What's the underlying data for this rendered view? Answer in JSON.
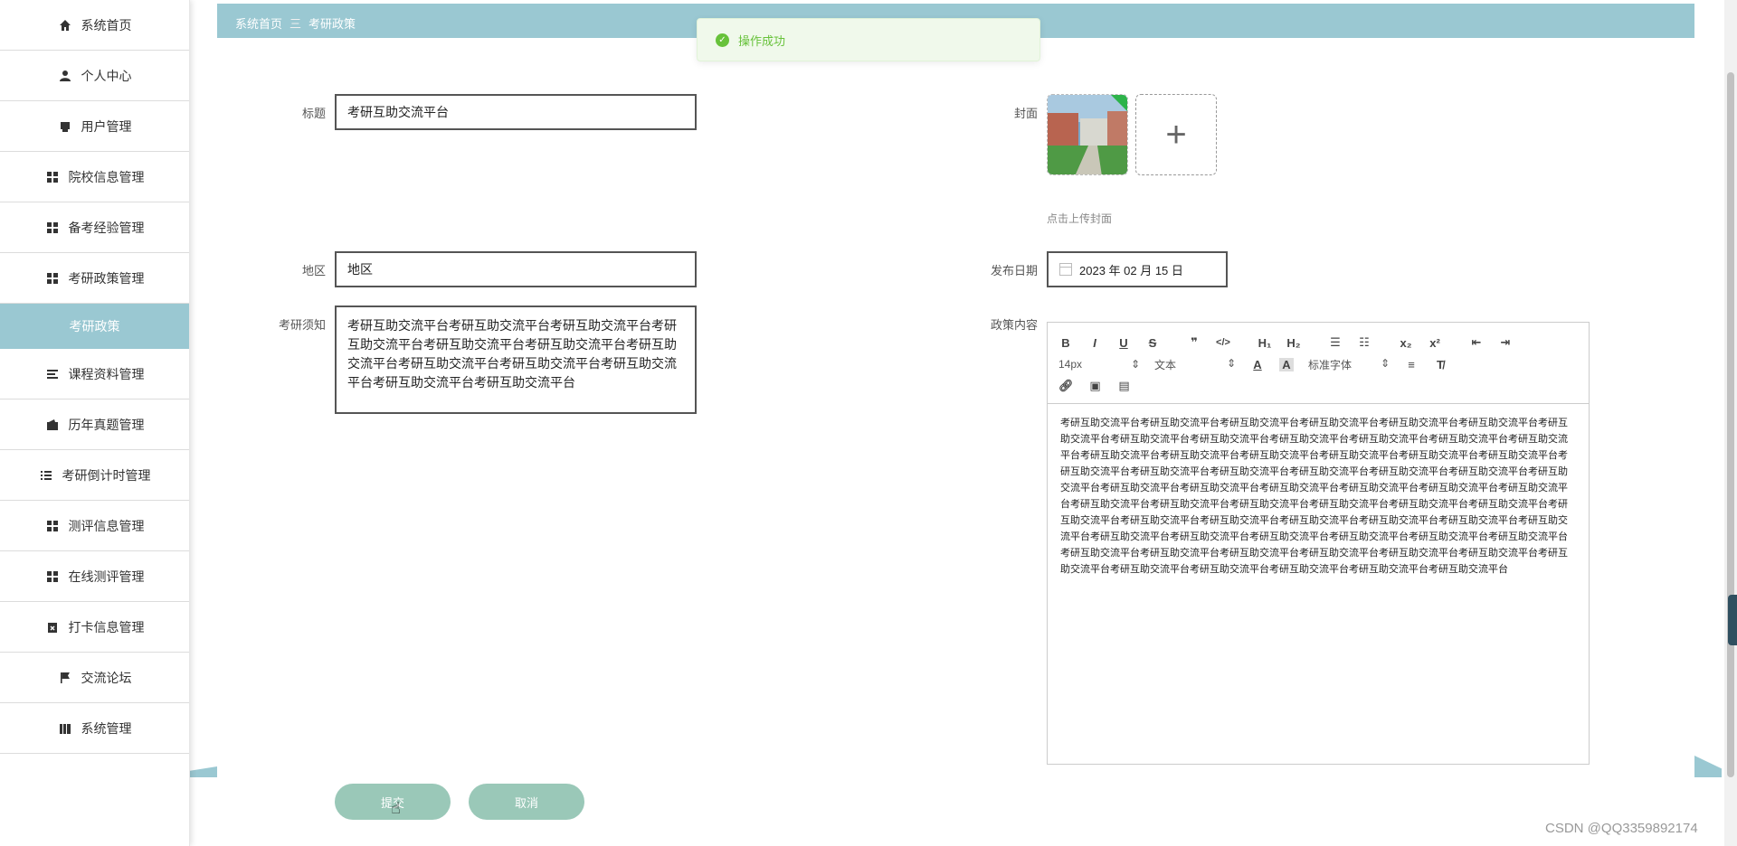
{
  "sidebar": {
    "items": [
      {
        "label": "系统首页",
        "icon": "home-icon"
      },
      {
        "label": "个人中心",
        "icon": "user-icon"
      },
      {
        "label": "用户管理",
        "icon": "printer-icon"
      },
      {
        "label": "院校信息管理",
        "icon": "grid-icon"
      },
      {
        "label": "备考经验管理",
        "icon": "grid-icon"
      },
      {
        "label": "考研政策管理",
        "icon": "grid-icon"
      },
      {
        "label": "考研政策",
        "icon": "",
        "active": true
      },
      {
        "label": "课程资料管理",
        "icon": "list-icon"
      },
      {
        "label": "历年真题管理",
        "icon": "wallet-icon"
      },
      {
        "label": "考研倒计时管理",
        "icon": "list-indent-icon"
      },
      {
        "label": "测评信息管理",
        "icon": "grid-icon"
      },
      {
        "label": "在线测评管理",
        "icon": "grid-icon"
      },
      {
        "label": "打卡信息管理",
        "icon": "clipboard-icon"
      },
      {
        "label": "交流论坛",
        "icon": "flag-icon"
      },
      {
        "label": "系统管理",
        "icon": "book-icon"
      }
    ]
  },
  "breadcrumb": {
    "home": "系统首页",
    "sep": "三",
    "current": "考研政策"
  },
  "toast": {
    "message": "操作成功"
  },
  "form": {
    "title_label": "标题",
    "title_value": "考研互助交流平台",
    "cover_label": "封面",
    "cover_hint": "点击上传封面",
    "region_label": "地区",
    "region_value": "地区",
    "date_label": "发布日期",
    "date_value": "2023 年 02 月 15 日",
    "notice_label": "考研须知",
    "notice_value": "考研互助交流平台考研互助交流平台考研互助交流平台考研互助交流平台考研互助交流平台考研互助交流平台考研互助交流平台考研互助交流平台考研互助交流平台考研互助交流平台考研互助交流平台考研互助交流平台",
    "content_label": "政策内容",
    "content_value": "考研互助交流平台考研互助交流平台考研互助交流平台考研互助交流平台考研互助交流平台考研互助交流平台考研互助交流平台考研互助交流平台考研互助交流平台考研互助交流平台考研互助交流平台考研互助交流平台考研互助交流平台考研互助交流平台考研互助交流平台考研互助交流平台考研互助交流平台考研互助交流平台考研互助交流平台考研互助交流平台考研互助交流平台考研互助交流平台考研互助交流平台考研互助交流平台考研互助交流平台考研互助交流平台考研互助交流平台考研互助交流平台考研互助交流平台考研互助交流平台考研互助交流平台考研互助交流平台考研互助交流平台考研互助交流平台考研互助交流平台考研互助交流平台考研互助交流平台考研互助交流平台考研互助交流平台考研互助交流平台考研互助交流平台考研互助交流平台考研互助交流平台考研互助交流平台考研互助交流平台考研互助交流平台考研互助交流平台考研互助交流平台考研互助交流平台考研互助交流平台考研互助交流平台考研互助交流平台考研互助交流平台考研互助交流平台考研互助交流平台考研互助交流平台考研互助交流平台考研互助交流平台考研互助交流平台考研互助交流平台考研互助交流平台考研互助交流平台考研互助交流平台"
  },
  "editor": {
    "font_size": "14px",
    "format": "文本",
    "font_family": "标准字体"
  },
  "buttons": {
    "submit": "提交",
    "cancel": "取消"
  },
  "watermark": "CSDN @QQ3359892174",
  "colors": {
    "accent": "#9ac8d2",
    "button": "#9ac8b8",
    "success": "#67c23a"
  }
}
